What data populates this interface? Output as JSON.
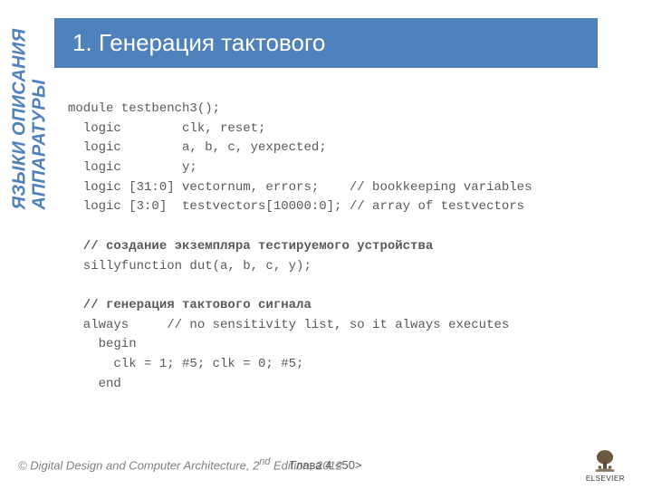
{
  "title": "1. Генерация тактового",
  "side_label_line1": "ЯЗЫКИ ОПИСАНИЯ",
  "side_label_line2": "АППАРАТУРЫ",
  "code": {
    "l1": "module testbench3();",
    "l2": "  logic        clk, reset;",
    "l3": "  logic        a, b, c, yexpected;",
    "l4": "  logic        y;",
    "l5": "  logic [31:0] vectornum, errors;    // bookkeeping variables",
    "l6": "  logic [3:0]  testvectors[10000:0]; // array of testvectors",
    "l7": " ",
    "l8": "  // создание экземпляра тестируемого устройства",
    "l9": "  sillyfunction dut(a, b, c, y);",
    "l10": " ",
    "l11": "  // генерация тактового сигнала",
    "l12": "  always     // no sensitivity list, so it always executes",
    "l13": "    begin",
    "l14": "      clk = 1; #5; clk = 0; #5;",
    "l15": "    end"
  },
  "footer": {
    "left_part1": "© Digital Design and Computer Architecture, ",
    "left_part2": "2",
    "left_part3": "nd",
    "left_part4": " Edition, 2012",
    "center": "Глава 4 <50>",
    "publisher": "ELSEVIER"
  }
}
